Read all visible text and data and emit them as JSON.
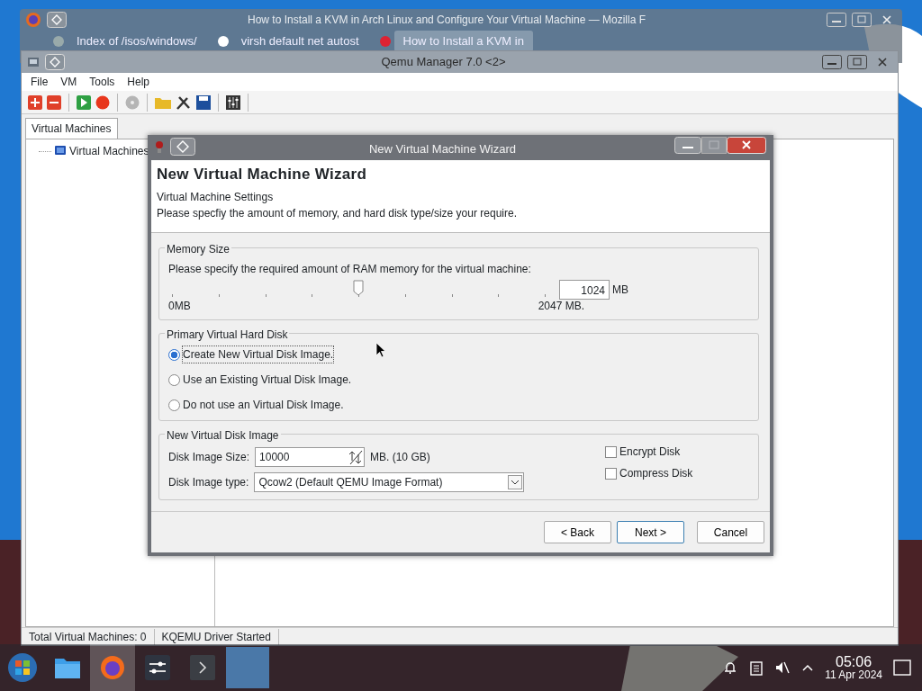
{
  "browser_window": {
    "title": "How to Install a KVM in Arch Linux and Configure Your Virtual Machine — Mozilla F",
    "tabs": [
      {
        "label": "Index of /isos/windows/",
        "selected": false
      },
      {
        "label": "virsh default net autost",
        "selected": false
      },
      {
        "label": "How to Install a KVM in",
        "selected": true
      }
    ]
  },
  "qemu_window": {
    "title": "Qemu Manager 7.0 <2>",
    "menu": [
      "File",
      "VM",
      "Tools",
      "Help"
    ],
    "tabs": [
      {
        "label": "Virtual Machines",
        "selected": true
      }
    ],
    "tree": [
      {
        "label": "Virtual Machines"
      }
    ],
    "status_bar": [
      "Total Virtual Machines: 0",
      "KQEMU Driver Started"
    ]
  },
  "wizard": {
    "window_title": "New Virtual Machine Wizard",
    "heading": "New Virtual Machine Wizard",
    "subheading": "Virtual Machine Settings",
    "description": "Please specfiy the amount of memory, and hard disk type/size your require.",
    "memory": {
      "legend": "Memory Size",
      "prompt": "Please specify the required amount of RAM memory for the virtual machine:",
      "level": 0.5,
      "value": "1024",
      "unit": "MB",
      "min_label": "0MB",
      "max_label": "2047 MB."
    },
    "disk": {
      "legend": "Primary Virtual Hard Disk",
      "options": [
        {
          "label": "Create New Virtual Disk Image.",
          "selected": true
        },
        {
          "label": "Use an  Existing Virtual Disk Image.",
          "selected": false
        },
        {
          "label": "Do not use an Virtual Disk Image.",
          "selected": false
        }
      ]
    },
    "new_disk": {
      "legend": "New Virtual Disk Image",
      "size_label": "Disk Image Size:",
      "size_value": "10000",
      "size_note": "MB. (10 GB)",
      "type_label": "Disk Image type:",
      "type_value": "Qcow2  (Default QEMU Image Format)",
      "options": [
        {
          "label": "Encrypt Disk",
          "checked": false
        },
        {
          "label": "Compress Disk",
          "checked": false
        }
      ]
    },
    "buttons": [
      {
        "kind": "back",
        "label": "< Back"
      },
      {
        "kind": "next",
        "label": "Next >"
      },
      {
        "kind": "cancel",
        "label": "Cancel"
      }
    ]
  },
  "taskbar": {
    "apps": [
      {
        "kind": "files",
        "selected": false
      },
      {
        "kind": "browser",
        "selected": true
      },
      {
        "kind": "mixer",
        "selected": false
      },
      {
        "kind": "terminal",
        "selected": false
      },
      {
        "kind": "window",
        "selected": false
      }
    ],
    "time": "05:06",
    "date": "11 Apr 2024"
  }
}
